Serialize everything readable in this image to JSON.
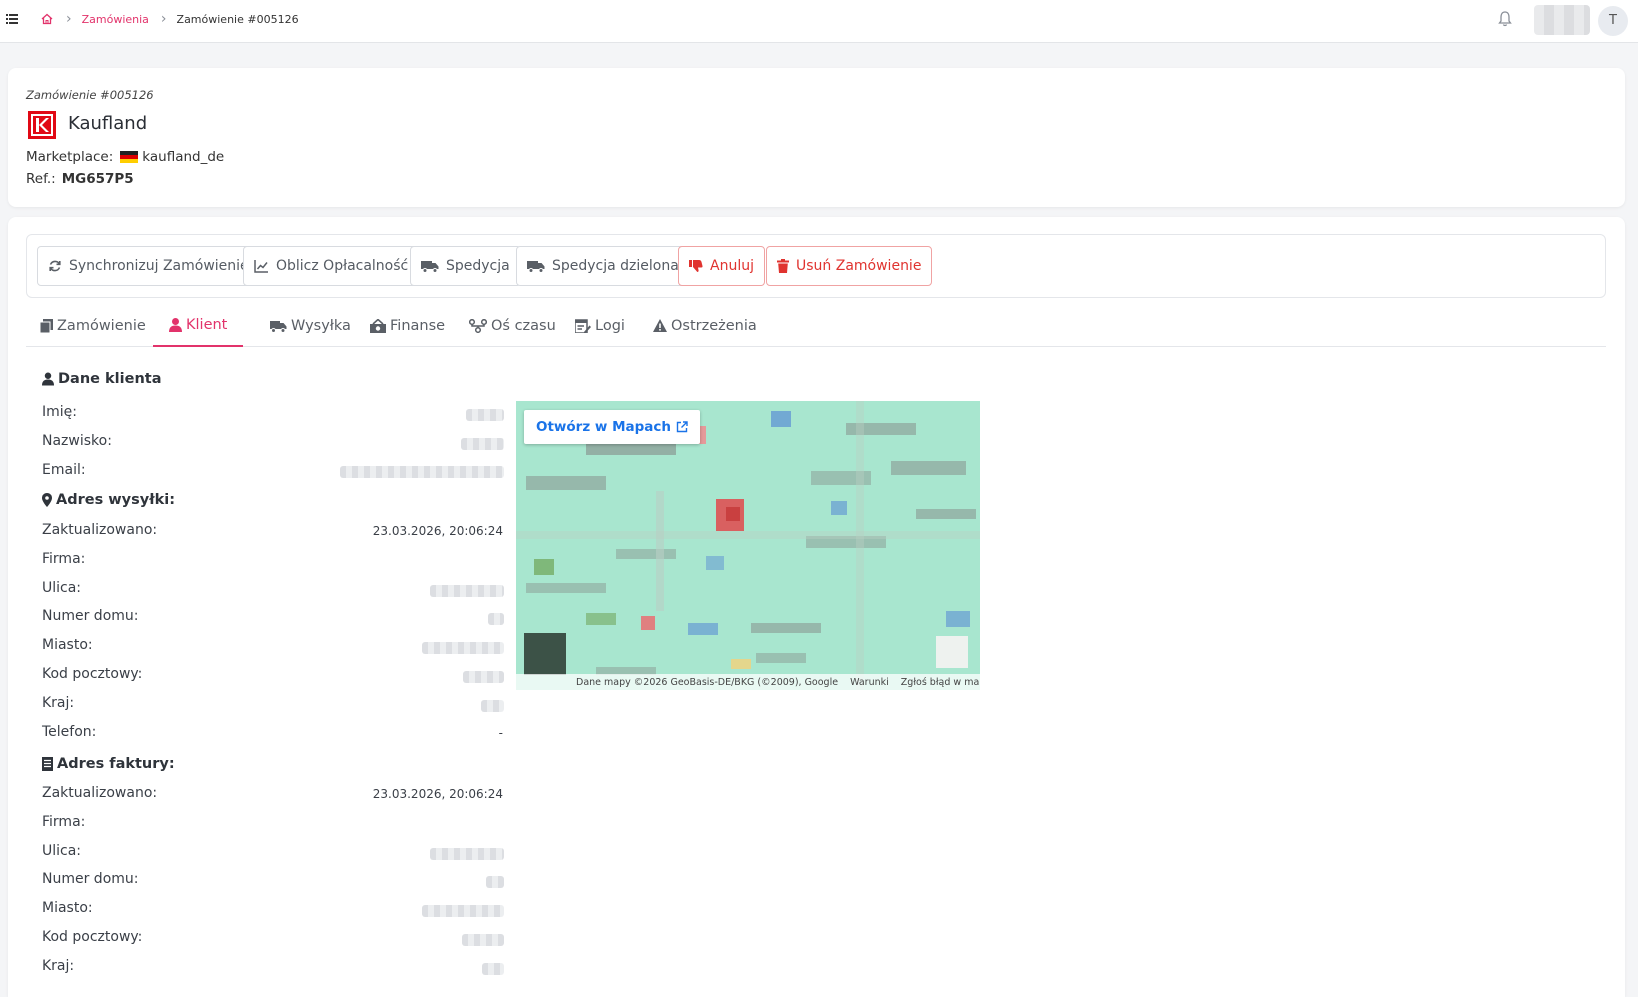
{
  "breadcrumb": {
    "items": [
      "Zamówienia",
      "Zamówienie #005126"
    ]
  },
  "user": {
    "initial": "T"
  },
  "order": {
    "label": "Zamówienie #005126",
    "shop_name": "Kaufland",
    "marketplace_label": "Marketplace:",
    "marketplace_value": "kaufland_de",
    "ref_label": "Ref.:",
    "ref_value": "MG657P5"
  },
  "toolbar": {
    "buttons": [
      {
        "label": "Synchronizuj Zamówienie",
        "icon": "sync-icon",
        "style": "default"
      },
      {
        "label": "Oblicz Opłacalność",
        "icon": "chart-line-icon",
        "style": "default"
      },
      {
        "label": "Spedycja",
        "icon": "truck-icon",
        "style": "default"
      },
      {
        "label": "Spedycja dzielona",
        "icon": "truck-icon",
        "style": "default"
      },
      {
        "label": "Anuluj",
        "icon": "thumbs-down-icon",
        "style": "danger"
      },
      {
        "label": "Usuń Zamówienie",
        "icon": "trash-icon",
        "style": "danger"
      }
    ]
  },
  "tabs": [
    {
      "label": "Zamówienie",
      "icon": "copy-icon",
      "active": false
    },
    {
      "label": "Klient",
      "icon": "user-icon",
      "active": true
    },
    {
      "label": "Wysyłka",
      "icon": "truck-fast-icon",
      "active": false
    },
    {
      "label": "Finanse",
      "icon": "money-icon",
      "active": false
    },
    {
      "label": "Oś czasu",
      "icon": "timeline-icon",
      "active": false
    },
    {
      "label": "Logi",
      "icon": "logs-icon",
      "active": false
    },
    {
      "label": "Ostrzeżenia",
      "icon": "warning-icon",
      "active": false
    }
  ],
  "customer": {
    "title": "Dane klienta",
    "fields": [
      "Imię:",
      "Nazwisko:",
      "Email:"
    ]
  },
  "shipping": {
    "title": "Adres wysyłki:",
    "updated_label": "Zaktualizowano:",
    "updated_value": "23.03.2026, 20:06:24",
    "fields": [
      "Firma:",
      "Ulica:",
      "Numer domu:",
      "Miasto:",
      "Kod pocztowy:",
      "Kraj:",
      "Telefon:"
    ],
    "phone_value": "-"
  },
  "billing": {
    "title": "Adres faktury:",
    "updated_label": "Zaktualizowano:",
    "updated_value": "23.03.2026, 20:06:24",
    "fields": [
      "Firma:",
      "Ulica:",
      "Numer domu:",
      "Miasto:",
      "Kod pocztowy:",
      "Kraj:"
    ]
  },
  "map": {
    "open_label": "Otwórz w Mapach",
    "footer": [
      "Dane mapy ©2026 GeoBasis-DE/BKG (©2009), Google",
      "Warunki",
      "Zgłoś błąd w mapach"
    ]
  },
  "colors": {
    "accent": "#e2336b",
    "danger": "#e0332f",
    "map_green": "#a8e6cf",
    "link_blue": "#1a73e8"
  }
}
